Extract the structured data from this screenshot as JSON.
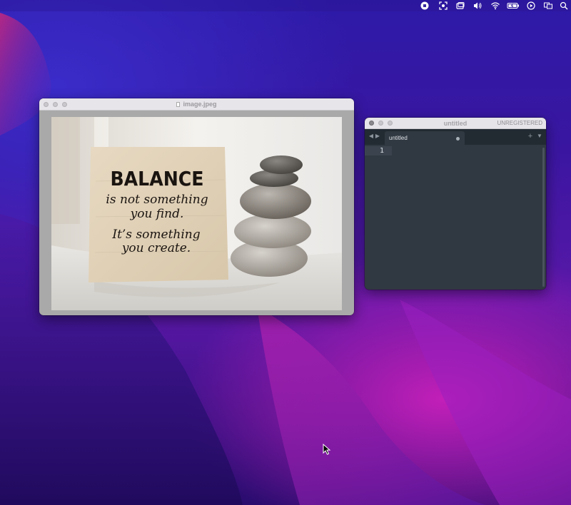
{
  "menubar": {
    "icons": [
      "screen-record-stop-icon",
      "screenshot-icon",
      "display-mirror-icon",
      "volume-icon",
      "wifi-icon",
      "battery-charging-icon",
      "play-circle-icon",
      "keyboard-input-icon",
      "spotlight-search-icon"
    ]
  },
  "preview": {
    "title": "image.jpeg",
    "photo": {
      "heading": "BALANCE",
      "line1": "is not something",
      "line2": "you find.",
      "line3": "It’s something",
      "line4": "you create."
    }
  },
  "editor": {
    "title": "untitled",
    "registration": "UNREGISTERED",
    "tab_label": "untitled",
    "line_number": "1"
  },
  "colors": {
    "editor_bg": "#303841",
    "tabbar_bg": "#222a32",
    "titlebar_bg": "#e7e5e9"
  }
}
